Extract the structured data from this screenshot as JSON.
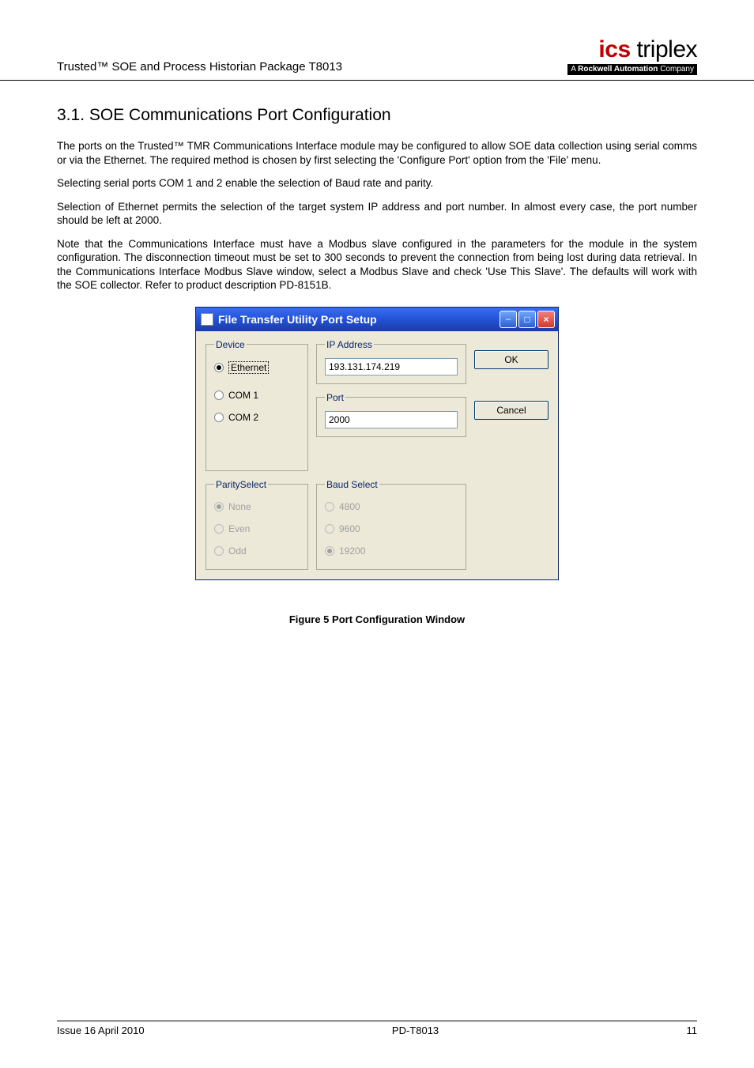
{
  "header": {
    "left": "Trusted™ SOE and Process Historian Package T8013",
    "logo_main_red": "ics",
    "logo_main_black": " triplex",
    "logo_sub_prefix": "A ",
    "logo_sub_bold": "Rockwell Automation",
    "logo_sub_suffix": " Company"
  },
  "section": {
    "number": "3.1.",
    "title": "SOE Communications Port Configuration"
  },
  "paragraphs": {
    "p1": "The ports on the Trusted™ TMR Communications Interface module may be configured to allow SOE data collection using serial comms or via the Ethernet.  The required method is chosen by first selecting the 'Configure Port' option from the 'File' menu.",
    "p2": "Selecting serial ports COM 1 and 2 enable the selection of Baud rate and parity.",
    "p3": "Selection of Ethernet permits the selection of the target system IP address and port number.  In almost every case, the port number should be left at 2000.",
    "p4": "Note that the Communications Interface must have a Modbus slave configured in the parameters for the module in the system configuration. The disconnection timeout must be set to 300 seconds to prevent the connection from being lost during data retrieval. In the Communications Interface Modbus Slave window, select a Modbus Slave and check 'Use This Slave'. The defaults will work with the SOE collector. Refer to product description PD-8151B."
  },
  "dialog": {
    "title": "File Transfer Utility Port Setup",
    "device": {
      "legend": "Device",
      "options": {
        "ethernet": "Ethernet",
        "com1": "COM 1",
        "com2": "COM 2"
      }
    },
    "ip": {
      "legend": "IP Address",
      "value": "193.131.174.219"
    },
    "port": {
      "legend": "Port",
      "value": "2000"
    },
    "parity": {
      "legend": "ParitySelect",
      "options": {
        "none": "None",
        "even": "Even",
        "odd": "Odd"
      }
    },
    "baud": {
      "legend": "Baud Select",
      "options": {
        "b4800": "4800",
        "b9600": "9600",
        "b19200": "19200"
      }
    },
    "buttons": {
      "ok": "OK",
      "cancel": "Cancel"
    }
  },
  "caption": "Figure 5 Port Configuration Window",
  "footer": {
    "left": "Issue 16 April 2010",
    "center": "PD-T8013",
    "right": "11"
  }
}
